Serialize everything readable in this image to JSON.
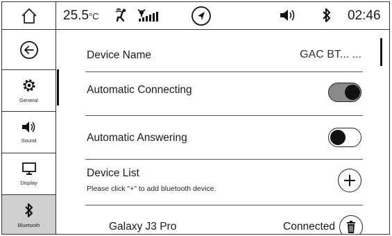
{
  "status_bar": {
    "temperature": "25.5",
    "temperature_unit": "°C",
    "time": "02:46"
  },
  "sidebar": {
    "items": [
      {
        "label": "General",
        "icon": "gear-icon"
      },
      {
        "label": "Sound",
        "icon": "speaker-icon"
      },
      {
        "label": "Display",
        "icon": "monitor-icon"
      },
      {
        "label": "Bluetooth",
        "icon": "bluetooth-icon",
        "active": true
      }
    ]
  },
  "settings": {
    "device_name": {
      "label": "Device Name",
      "value": "GAC BT... ..."
    },
    "automatic_connecting": {
      "label": "Automatic Connecting",
      "enabled": true
    },
    "automatic_answering": {
      "label": "Automatic Answering",
      "enabled": false
    },
    "device_list": {
      "label": "Device List",
      "hint": "Please click \"+\" to add bluetooth device."
    },
    "devices": [
      {
        "name": "Galaxy J3 Pro",
        "status": "Connected"
      }
    ]
  },
  "colors": {
    "active_sidebar_bg": "#cfcfcf",
    "toggle_on_bg": "#8a8a8a",
    "knob": "#111111"
  }
}
